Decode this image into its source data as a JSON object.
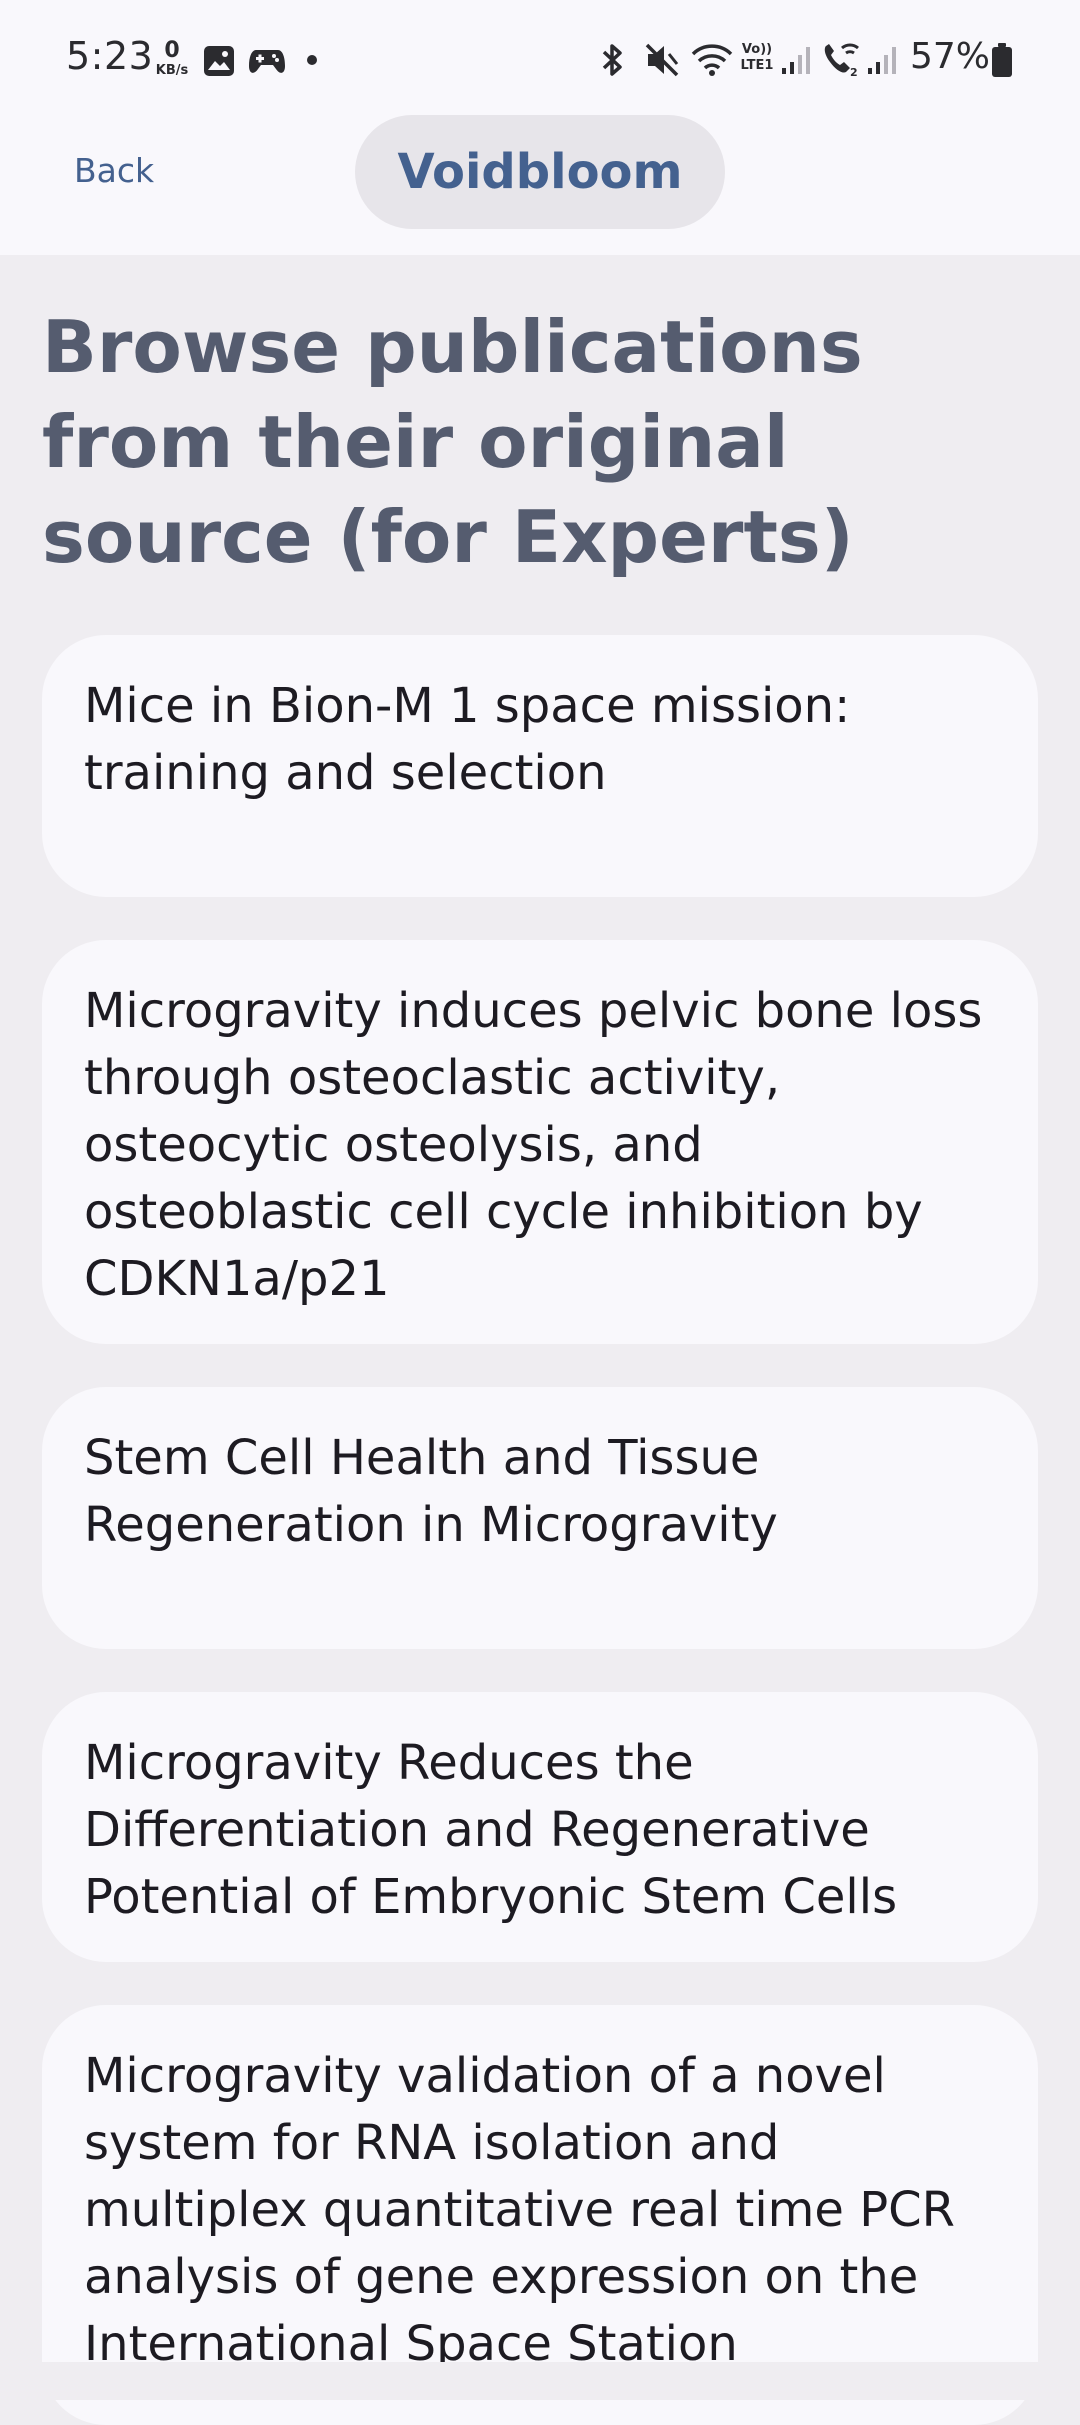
{
  "status_bar": {
    "time": "5:23",
    "net_speed_value": "0",
    "net_speed_unit": "KB/s",
    "battery_percent": "57%",
    "icons": [
      "gallery-icon",
      "game-controller-icon",
      "dot-icon",
      "bluetooth-icon",
      "mute-icon",
      "wifi-icon",
      "volte-lte-icon",
      "signal-icon",
      "wifi-calling-icon",
      "signal-icon",
      "battery-icon"
    ],
    "volte_label_top": "Vo))",
    "volte_label_bottom": "LTE1"
  },
  "app_bar": {
    "back_label": "Back",
    "title": "Voidbloom"
  },
  "page": {
    "heading": "Browse publications from their original source (for Experts)"
  },
  "publications": [
    {
      "title": "Mice in Bion-M 1 space mission: training and selection"
    },
    {
      "title": "Microgravity induces pelvic bone loss through osteoclastic activity, osteocytic osteolysis, and osteoblastic cell cycle inhibition by CDKN1a/p21"
    },
    {
      "title": "Stem Cell Health and Tissue Regeneration in Microgravity"
    },
    {
      "title": "Microgravity Reduces the Differentiation and Regenerative Potential of Embryonic Stem Cells"
    },
    {
      "title": "Microgravity validation of a novel system for RNA isolation and multiplex quantitative real time PCR analysis of gene expression on the International Space Station"
    }
  ],
  "colors": {
    "accent": "#44618f",
    "heading": "#555c6f",
    "background": "#efedf1",
    "card": "#f9f8fc"
  }
}
